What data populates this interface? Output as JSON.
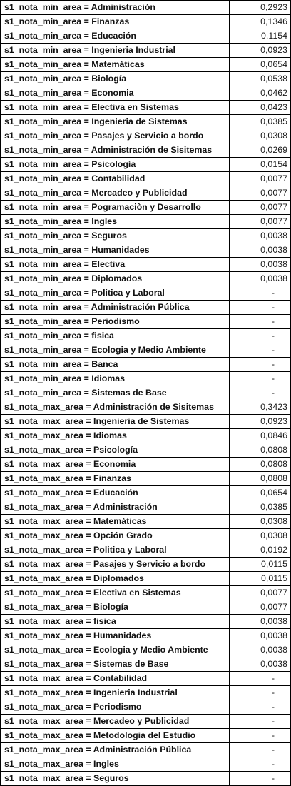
{
  "rows": [
    {
      "label": "s1_nota_min_area = Administración",
      "value": "0,2923"
    },
    {
      "label": "s1_nota_min_area = Finanzas",
      "value": "0,1346"
    },
    {
      "label": "s1_nota_min_area = Educación",
      "value": "0,1154"
    },
    {
      "label": "s1_nota_min_area = Ingenieria Industrial",
      "value": "0,0923"
    },
    {
      "label": "s1_nota_min_area = Matemáticas",
      "value": "0,0654"
    },
    {
      "label": "s1_nota_min_area = Biología",
      "value": "0,0538"
    },
    {
      "label": "s1_nota_min_area = Economia",
      "value": "0,0462"
    },
    {
      "label": "s1_nota_min_area = Electiva en Sistemas",
      "value": "0,0423"
    },
    {
      "label": "s1_nota_min_area = Ingenieria de Sistemas",
      "value": "0,0385"
    },
    {
      "label": "s1_nota_min_area = Pasajes y Servicio a bordo",
      "value": "0,0308"
    },
    {
      "label": "s1_nota_min_area = Administración de Sisitemas",
      "value": "0,0269"
    },
    {
      "label": "s1_nota_min_area = Psicología",
      "value": "0,0154"
    },
    {
      "label": "s1_nota_min_area = Contabilidad",
      "value": "0,0077"
    },
    {
      "label": "s1_nota_min_area = Mercadeo y Publicidad",
      "value": "0,0077"
    },
    {
      "label": "s1_nota_min_area = Pogramaciòn y Desarrollo",
      "value": "0,0077"
    },
    {
      "label": "s1_nota_min_area = Ingles",
      "value": "0,0077"
    },
    {
      "label": "s1_nota_min_area = Seguros",
      "value": "0,0038"
    },
    {
      "label": "s1_nota_min_area = Humanidades",
      "value": "0,0038"
    },
    {
      "label": "s1_nota_min_area = Electiva",
      "value": "0,0038"
    },
    {
      "label": "s1_nota_min_area = Diplomados",
      "value": "0,0038"
    },
    {
      "label": "s1_nota_min_area = Politica y Laboral",
      "value": "-"
    },
    {
      "label": "s1_nota_min_area = Administración Pública",
      "value": "-"
    },
    {
      "label": "s1_nota_min_area = Periodismo",
      "value": "-"
    },
    {
      "label": "s1_nota_min_area = fisica",
      "value": "-"
    },
    {
      "label": "s1_nota_min_area = Ecologia y Medio Ambiente",
      "value": "-"
    },
    {
      "label": "s1_nota_min_area = Banca",
      "value": "-"
    },
    {
      "label": "s1_nota_min_area = Idiomas",
      "value": "-"
    },
    {
      "label": "s1_nota_min_area = Sistemas de Base",
      "value": "-"
    },
    {
      "label": "s1_nota_max_area = Administración de Sisitemas",
      "value": "0,3423"
    },
    {
      "label": "s1_nota_max_area = Ingenieria de Sistemas",
      "value": "0,0923"
    },
    {
      "label": "s1_nota_max_area = Idiomas",
      "value": "0,0846"
    },
    {
      "label": "s1_nota_max_area = Psicología",
      "value": "0,0808"
    },
    {
      "label": "s1_nota_max_area = Economia",
      "value": "0,0808"
    },
    {
      "label": "s1_nota_max_area = Finanzas",
      "value": "0,0808"
    },
    {
      "label": "s1_nota_max_area = Educación",
      "value": "0,0654"
    },
    {
      "label": "s1_nota_max_area = Administración",
      "value": "0,0385"
    },
    {
      "label": "s1_nota_max_area = Matemáticas",
      "value": "0,0308"
    },
    {
      "label": "s1_nota_max_area = Opción Grado",
      "value": "0,0308"
    },
    {
      "label": "s1_nota_max_area = Politica y Laboral",
      "value": "0,0192"
    },
    {
      "label": "s1_nota_max_area = Pasajes y Servicio a bordo",
      "value": "0,0115"
    },
    {
      "label": "s1_nota_max_area = Diplomados",
      "value": "0,0115"
    },
    {
      "label": "s1_nota_max_area = Electiva en Sistemas",
      "value": "0,0077"
    },
    {
      "label": "s1_nota_max_area = Biología",
      "value": "0,0077"
    },
    {
      "label": "s1_nota_max_area = fisica",
      "value": "0,0038"
    },
    {
      "label": "s1_nota_max_area = Humanidades",
      "value": "0,0038"
    },
    {
      "label": "s1_nota_max_area = Ecologia y Medio Ambiente",
      "value": "0,0038"
    },
    {
      "label": "s1_nota_max_area = Sistemas de Base",
      "value": "0,0038"
    },
    {
      "label": "s1_nota_max_area = Contabilidad",
      "value": "-"
    },
    {
      "label": "s1_nota_max_area = Ingenieria Industrial",
      "value": "-"
    },
    {
      "label": "s1_nota_max_area = Periodismo",
      "value": "-"
    },
    {
      "label": "s1_nota_max_area = Mercadeo y Publicidad",
      "value": "-"
    },
    {
      "label": "s1_nota_max_area = Metodologia del Estudio",
      "value": "-"
    },
    {
      "label": "s1_nota_max_area = Administración Pública",
      "value": "-"
    },
    {
      "label": "s1_nota_max_area = Ingles",
      "value": "-"
    },
    {
      "label": "s1_nota_max_area = Seguros",
      "value": "-"
    }
  ]
}
